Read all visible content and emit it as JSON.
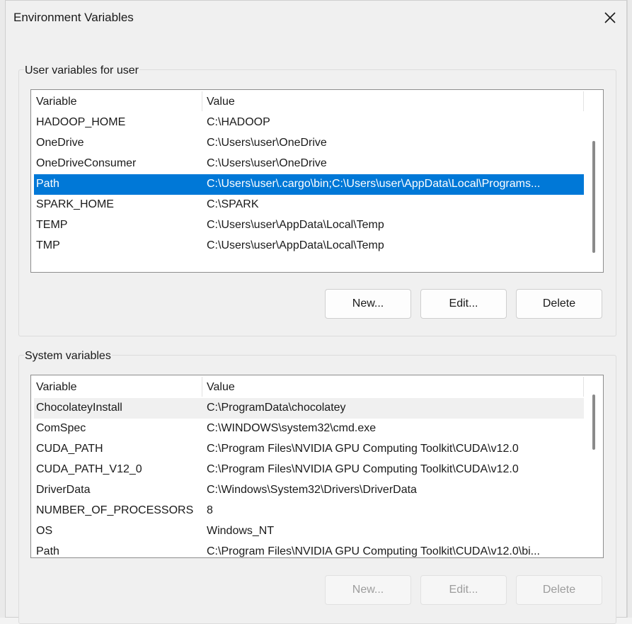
{
  "window": {
    "title": "Environment Variables",
    "close_icon": "close-icon"
  },
  "user_section": {
    "title": "User variables for user",
    "columns": [
      "Variable",
      "Value"
    ],
    "rows": [
      {
        "variable": "HADOOP_HOME",
        "value": "C:\\HADOOP"
      },
      {
        "variable": "OneDrive",
        "value": "C:\\Users\\user\\OneDrive"
      },
      {
        "variable": "OneDriveConsumer",
        "value": "C:\\Users\\user\\OneDrive"
      },
      {
        "variable": "Path",
        "value": "C:\\Users\\user\\.cargo\\bin;C:\\Users\\user\\AppData\\Local\\Programs..."
      },
      {
        "variable": "SPARK_HOME",
        "value": "C:\\SPARK"
      },
      {
        "variable": "TEMP",
        "value": "C:\\Users\\user\\AppData\\Local\\Temp"
      },
      {
        "variable": "TMP",
        "value": "C:\\Users\\user\\AppData\\Local\\Temp"
      }
    ],
    "selected_variable": "Path",
    "buttons": {
      "new": "New...",
      "edit": "Edit...",
      "delete": "Delete"
    }
  },
  "system_section": {
    "title": "System variables",
    "columns": [
      "Variable",
      "Value"
    ],
    "rows": [
      {
        "variable": "ChocolateyInstall",
        "value": "C:\\ProgramData\\chocolatey"
      },
      {
        "variable": "ComSpec",
        "value": "C:\\WINDOWS\\system32\\cmd.exe"
      },
      {
        "variable": "CUDA_PATH",
        "value": "C:\\Program Files\\NVIDIA GPU Computing Toolkit\\CUDA\\v12.0"
      },
      {
        "variable": "CUDA_PATH_V12_0",
        "value": "C:\\Program Files\\NVIDIA GPU Computing Toolkit\\CUDA\\v12.0"
      },
      {
        "variable": "DriverData",
        "value": "C:\\Windows\\System32\\Drivers\\DriverData"
      },
      {
        "variable": "NUMBER_OF_PROCESSORS",
        "value": "8"
      },
      {
        "variable": "OS",
        "value": "Windows_NT"
      },
      {
        "variable": "Path",
        "value": "C:\\Program Files\\NVIDIA GPU Computing Toolkit\\CUDA\\v12.0\\bi..."
      }
    ],
    "hovered_variable": "ChocolateyInstall",
    "buttons": {
      "new": "New...",
      "edit": "Edit...",
      "delete": "Delete"
    },
    "buttons_disabled": true
  },
  "colors": {
    "selection": "#0078d7",
    "dialog_bg": "#f0f0f0",
    "list_bg": "#ffffff"
  }
}
